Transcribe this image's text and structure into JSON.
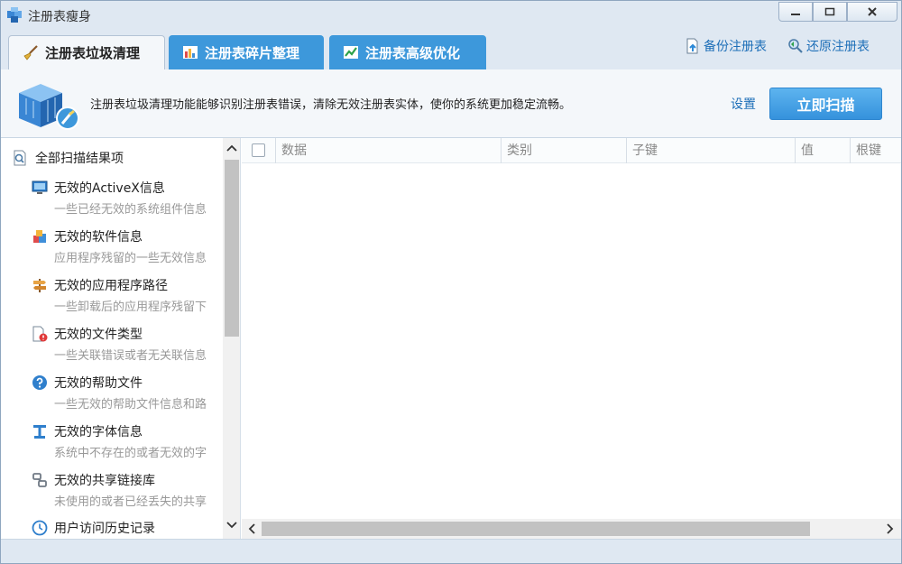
{
  "window": {
    "title": "注册表瘦身",
    "icon": "registry-cube-icon"
  },
  "tabs": [
    {
      "label": "注册表垃圾清理",
      "icon": "broom-icon",
      "active": true
    },
    {
      "label": "注册表碎片整理",
      "icon": "defrag-icon",
      "active": false
    },
    {
      "label": "注册表高级优化",
      "icon": "chart-up-icon",
      "active": false
    }
  ],
  "top_links": {
    "backup": "备份注册表",
    "restore": "还原注册表"
  },
  "header": {
    "description": "注册表垃圾清理功能能够识别注册表错误，清除无效注册表实体，使你的系统更加稳定流畅。",
    "settings_label": "设置",
    "scan_label": "立即扫描"
  },
  "categories": {
    "root_label": "全部扫描结果项",
    "items": [
      {
        "title": "无效的ActiveX信息",
        "subtitle": "一些已经无效的系统组件信息",
        "icon": "monitor-icon"
      },
      {
        "title": "无效的软件信息",
        "subtitle": "应用程序残留的一些无效信息",
        "icon": "software-box-icon"
      },
      {
        "title": "无效的应用程序路径",
        "subtitle": "一些卸载后的应用程序残留下",
        "icon": "signpost-icon"
      },
      {
        "title": "无效的文件类型",
        "subtitle": "一些关联错误或者无关联信息",
        "icon": "file-error-icon"
      },
      {
        "title": "无效的帮助文件",
        "subtitle": "一些无效的帮助文件信息和路",
        "icon": "help-icon"
      },
      {
        "title": "无效的字体信息",
        "subtitle": "系统中不存在的或者无效的字",
        "icon": "font-icon"
      },
      {
        "title": "无效的共享链接库",
        "subtitle": "未使用的或者已经丢失的共享",
        "icon": "link-library-icon"
      },
      {
        "title": "用户访问历史记录",
        "subtitle": "",
        "icon": "history-clock-icon"
      }
    ]
  },
  "columns": [
    "数据",
    "类别",
    "子键",
    "值",
    "根键"
  ]
}
